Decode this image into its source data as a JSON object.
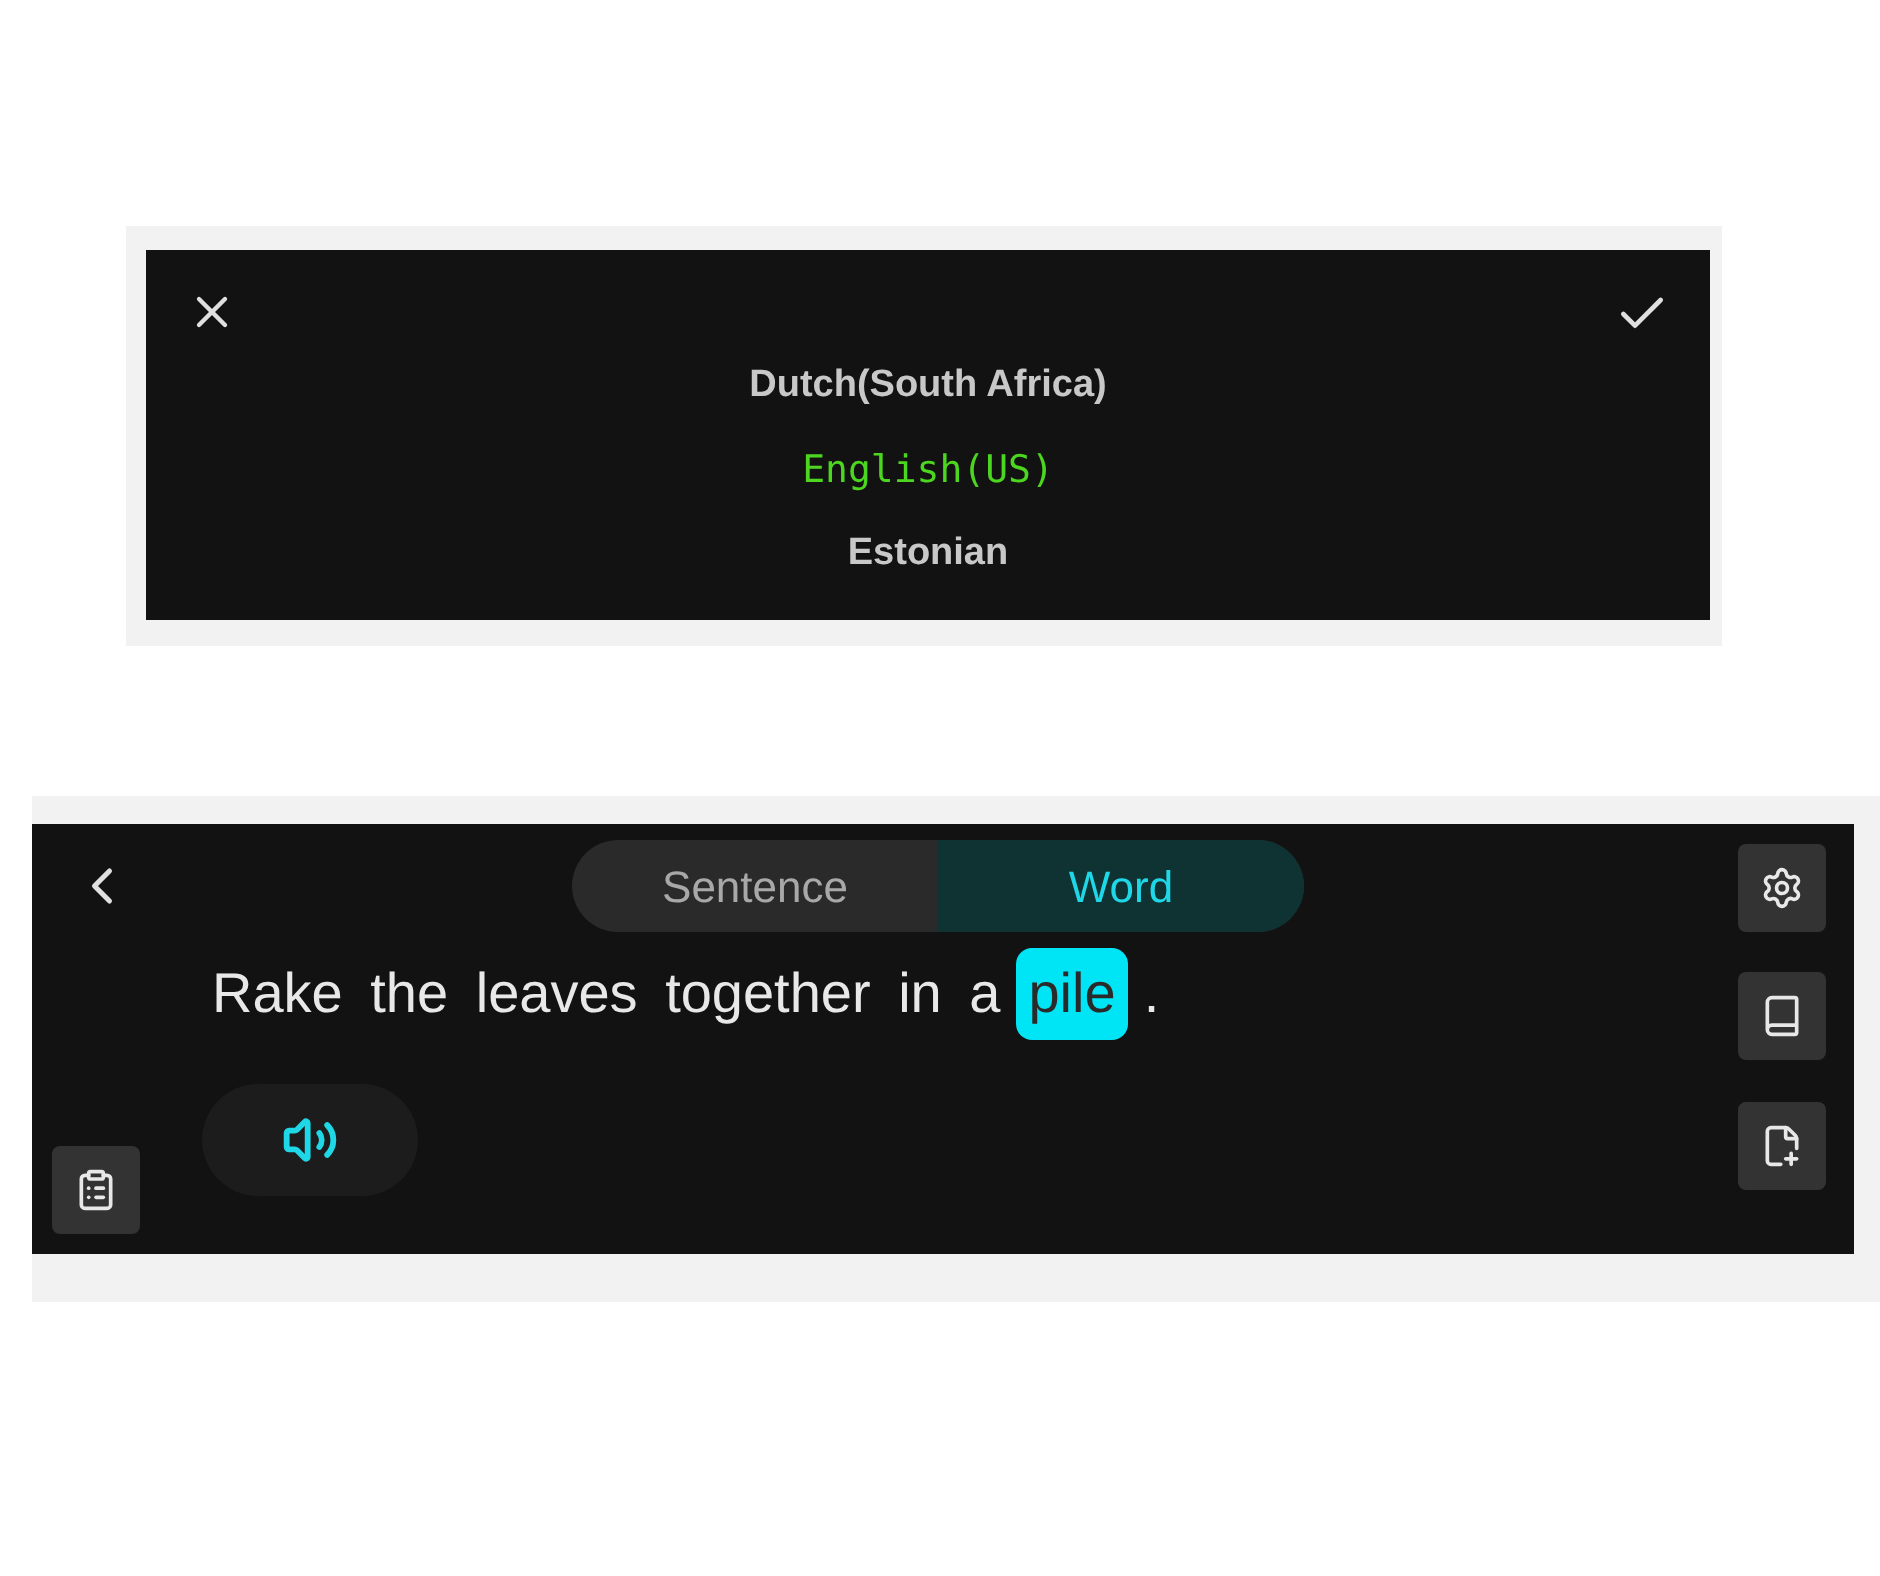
{
  "language_picker": {
    "options": [
      {
        "label": "Dutch(South Africa)",
        "selected": false
      },
      {
        "label": "English(US)",
        "selected": true
      },
      {
        "label": "Estonian",
        "selected": false
      }
    ]
  },
  "practice": {
    "tabs": [
      {
        "label": "Sentence",
        "selected": false
      },
      {
        "label": "Word",
        "selected": true
      }
    ],
    "sentence": [
      {
        "text": "Rake the leaves together in a",
        "highlighted": false
      },
      {
        "text": "pile",
        "highlighted": true
      },
      {
        "text": ".",
        "highlighted": false
      }
    ]
  }
}
